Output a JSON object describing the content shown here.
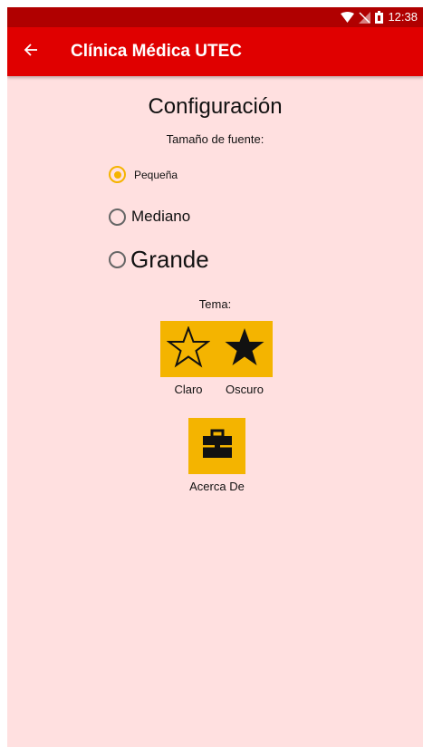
{
  "status_bar": {
    "time": "12:38",
    "icons": [
      "wifi-icon",
      "signal-icon",
      "battery-icon"
    ]
  },
  "app_bar": {
    "back_icon": "arrow-back-icon",
    "title": "Clínica Médica UTEC"
  },
  "settings": {
    "title": "Configuración",
    "font_size_label": "Tamaño de fuente:",
    "font_options": [
      {
        "label": "Pequeña",
        "selected": true
      },
      {
        "label": "Mediano",
        "selected": false
      },
      {
        "label": "Grande",
        "selected": false
      }
    ],
    "theme_label": "Tema:",
    "theme_options": [
      {
        "label": "Claro",
        "icon": "star-outline-icon"
      },
      {
        "label": "Oscuro",
        "icon": "star-filled-icon"
      }
    ],
    "about": {
      "label": "Acerca De",
      "icon": "briefcase-icon"
    }
  },
  "colors": {
    "status_bar": "#b00000",
    "app_bar": "#e00000",
    "background": "#ffe0e0",
    "accent": "#f4b400"
  }
}
